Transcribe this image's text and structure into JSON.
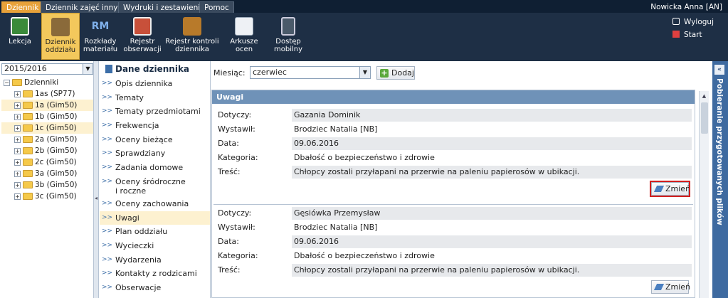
{
  "topbar": {
    "tabs": [
      "Dziennik",
      "Dziennik zajęć innych",
      "Wydruki i zestawienia",
      "Pomoc"
    ],
    "user": "Nowicka Anna [AN]"
  },
  "toolbar": {
    "buttons": [
      {
        "label": "Lekcja"
      },
      {
        "label": "Dziennik oddziału"
      },
      {
        "label": "Rozkłady materiału"
      },
      {
        "label": "Rejestr obserwacji"
      },
      {
        "label": "Rejestr kontroli dziennika"
      },
      {
        "label": "Arkusze ocen"
      },
      {
        "label": "Dostęp mobilny"
      }
    ],
    "logout": "Wyloguj",
    "start": "Start",
    "icon_colors": [
      "#3a8a3a",
      "#8a6a3a",
      "#2f6fb8",
      "#c8503a",
      "#b87a2a",
      "#6a7a8a",
      "#4a5a6a"
    ]
  },
  "left": {
    "year": "2015/2016",
    "root": "Dzienniki",
    "classes": [
      "1as (SP77)",
      "1a (Gim50)",
      "1b (Gim50)",
      "1c (Gim50)",
      "2a (Gim50)",
      "2b (Gim50)",
      "2c (Gim50)",
      "3a (Gim50)",
      "3b (Gim50)",
      "3c (Gim50)"
    ]
  },
  "nav": {
    "title": "Dane dziennika",
    "items": [
      "Opis dziennika",
      "Tematy",
      "Tematy przedmiotami",
      "Frekwencja",
      "Oceny bieżące",
      "Sprawdziany",
      "Zadania domowe",
      "Oceny śródroczne i roczne",
      "Oceny zachowania",
      "Uwagi",
      "Plan oddziału",
      "Wycieczki",
      "Wydarzenia",
      "Kontakty z rodzicami",
      "Obserwacje"
    ]
  },
  "filter": {
    "month_label": "Miesiąc:",
    "month_value": "czerwiec",
    "add_label": "Dodaj"
  },
  "section": {
    "title": "Uwagi",
    "records": [
      {
        "k1": "Dotyczy:",
        "v1": "Gazania Dominik",
        "k2": "Wystawił:",
        "v2": "Brodziec Natalia [NB]",
        "k3": "Data:",
        "v3": "09.06.2016",
        "k4": "Kategoria:",
        "v4": "Dbałość o bezpieczeństwo i zdrowie",
        "k5": "Treść:",
        "v5": "Chłopcy zostali przyłapani na przerwie na paleniu papierosów w ubikacji.",
        "change": "Zmień"
      },
      {
        "k1": "Dotyczy:",
        "v1": "Gęsiówka Przemysław",
        "k2": "Wystawił:",
        "v2": "Brodziec Natalia [NB]",
        "k3": "Data:",
        "v3": "09.06.2016",
        "k4": "Kategoria:",
        "v4": "Dbałość o bezpieczeństwo i zdrowie",
        "k5": "Treść:",
        "v5": "Chłopcy zostali przyłapani na przerwie na paleniu papierosów w ubikacji.",
        "change": "Zmień"
      }
    ]
  },
  "rightpanel": {
    "label": "Pobieranie przygotowanych plików"
  },
  "colors": {
    "accent": "#e8a23a",
    "header_bg": "#1e2f45",
    "section_head": "#6f92b8",
    "highlight": "#d21f1f"
  }
}
